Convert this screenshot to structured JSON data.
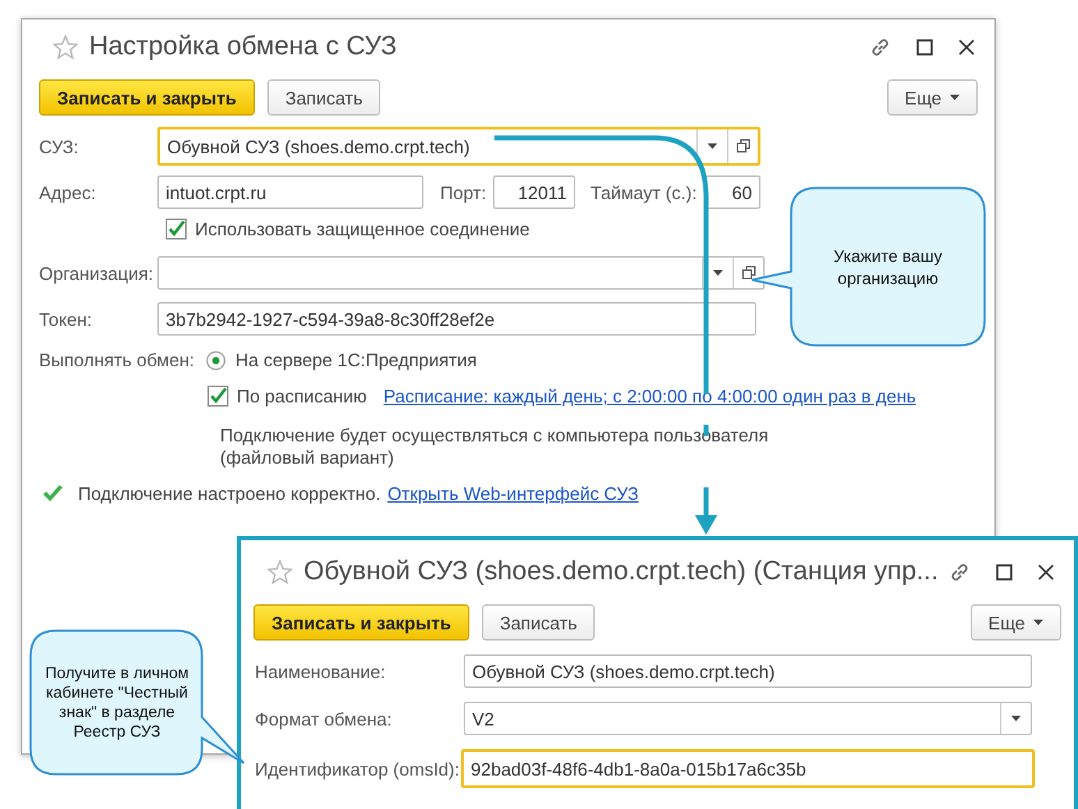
{
  "main_window": {
    "title": "Настройка обмена с СУЗ",
    "buttons": [
      {
        "label": "Записать и закрыть",
        "default": true
      },
      {
        "label": "Записать",
        "default": false
      }
    ],
    "more_button": "Еще",
    "suz": {
      "label": "СУЗ:",
      "value": "Обувной СУЗ (shoes.demo.crpt.tech)",
      "highlighted": true
    },
    "address": {
      "label": "Адрес:",
      "value": "intuot.crpt.ru"
    },
    "port": {
      "label": "Порт:",
      "value": "12011"
    },
    "timeout": {
      "label": "Таймаут (с.):",
      "value": "60"
    },
    "secure_connection": {
      "label": "Использовать защищенное соединение",
      "checked": true
    },
    "organization": {
      "label": "Организация:",
      "highlighted": false
    },
    "token": {
      "label": "Токен:",
      "value": "3b7b2942-1927-c594-39a8-8c30ff28ef2e"
    },
    "exchange": {
      "label": "Выполнять обмен:",
      "option": "На сервере 1С:Предприятия",
      "selected": true
    },
    "schedule": {
      "label": "По расписанию",
      "checked": true,
      "link": "Расписание: каждый день; с 2:00:00 по 4:00:00 один раз в день"
    },
    "note": "Подключение будет осуществляться с компьютера пользователя\n(файловый вариант)",
    "status": {
      "ok": true,
      "text": "Подключение настроено корректно.",
      "link": "Открыть Web-интерфейс СУЗ"
    }
  },
  "station_window": {
    "title": "Обувной СУЗ (shoes.demo.crpt.tech) (Станция упр...",
    "buttons": [
      {
        "label": "Записать и закрыть",
        "default": true
      },
      {
        "label": "Записать",
        "default": false
      }
    ],
    "more_button": "Еще",
    "fields": [
      {
        "kind": "text",
        "label": "Наименование:",
        "value": "Обувной СУЗ (shoes.demo.crpt.tech)",
        "highlighted": false
      },
      {
        "kind": "select",
        "label": "Формат обмена:",
        "value": "V2",
        "highlighted": false
      },
      {
        "kind": "text",
        "label": "Идентификатор (omsId):",
        "value": "92bad03f-48f6-4db1-8a0a-015b17a6c35b",
        "highlighted": true
      }
    ]
  },
  "callouts": [
    "Укажите вашу организацию",
    "Получите в личном кабинете \"Честный знак\" в разделе Реестр СУЗ"
  ]
}
